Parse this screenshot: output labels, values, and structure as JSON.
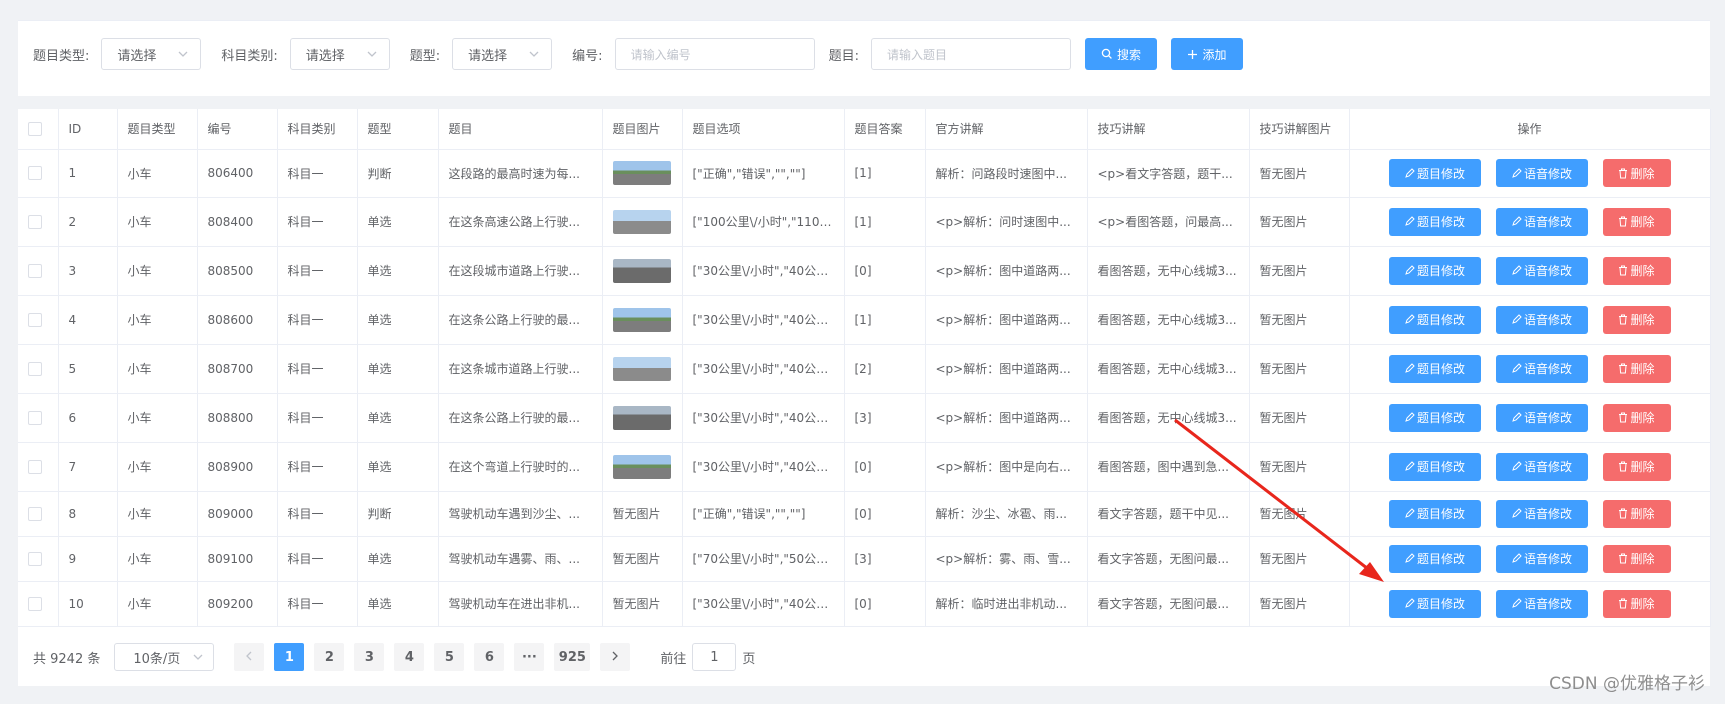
{
  "filters": {
    "type_label": "题目类型:",
    "type_value": "请选择",
    "subject_label": "科目类别:",
    "subject_value": "请选择",
    "kind_label": "题型:",
    "kind_value": "请选择",
    "code_label": "编号:",
    "code_placeholder": "请输入编号",
    "title_label": "题目:",
    "title_placeholder": "请输入题目",
    "search_label": "搜索",
    "add_label": "添加"
  },
  "table": {
    "headers": [
      "ID",
      "题目类型",
      "编号",
      "科目类别",
      "题型",
      "题目",
      "题目图片",
      "题目选项",
      "题目答案",
      "官方讲解",
      "技巧讲解",
      "技巧讲解图片",
      "操作"
    ],
    "edit_label": "题目修改",
    "voice_label": "语音修改",
    "delete_label": "删除",
    "rows": [
      {
        "id": "1",
        "type": "小车",
        "code": "806400",
        "subject": "科目一",
        "kind": "判断",
        "title": "这段路的最高时速为每...",
        "image": "photo",
        "options": "[\"正确\",\"错误\",\"\",\"\"]",
        "answer": "[1]",
        "official": "解析：问路段时速图中...",
        "tip": "<p>看文字答题，题干...",
        "tip_image": "暂无图片"
      },
      {
        "id": "2",
        "type": "小车",
        "code": "808400",
        "subject": "科目一",
        "kind": "单选",
        "title": "在这条高速公路上行驶...",
        "image": "photo",
        "options": "[\"100公里\\/小时\",\"110公...",
        "answer": "[1]",
        "official": "<p>解析：问时速图中...",
        "tip": "<p>看图答题，问最高...",
        "tip_image": "暂无图片"
      },
      {
        "id": "3",
        "type": "小车",
        "code": "808500",
        "subject": "科目一",
        "kind": "单选",
        "title": "在这段城市道路上行驶...",
        "image": "photo",
        "options": "[\"30公里\\/小时\",\"40公里...",
        "answer": "[0]",
        "official": "<p>解析：图中道路两...",
        "tip": "看图答题，无中心线城3...",
        "tip_image": "暂无图片"
      },
      {
        "id": "4",
        "type": "小车",
        "code": "808600",
        "subject": "科目一",
        "kind": "单选",
        "title": "在这条公路上行驶的最...",
        "image": "photo",
        "options": "[\"30公里\\/小时\",\"40公里...",
        "answer": "[1]",
        "official": "<p>解析：图中道路两...",
        "tip": "看图答题，无中心线城3...",
        "tip_image": "暂无图片"
      },
      {
        "id": "5",
        "type": "小车",
        "code": "808700",
        "subject": "科目一",
        "kind": "单选",
        "title": "在这条城市道路上行驶...",
        "image": "photo",
        "options": "[\"30公里\\/小时\",\"40公里...",
        "answer": "[2]",
        "official": "<p>解析：图中道路两...",
        "tip": "看图答题，无中心线城3...",
        "tip_image": "暂无图片"
      },
      {
        "id": "6",
        "type": "小车",
        "code": "808800",
        "subject": "科目一",
        "kind": "单选",
        "title": "在这条公路上行驶的最...",
        "image": "photo",
        "options": "[\"30公里\\/小时\",\"40公里...",
        "answer": "[3]",
        "official": "<p>解析：图中道路两...",
        "tip": "看图答题，无中心线城3...",
        "tip_image": "暂无图片"
      },
      {
        "id": "7",
        "type": "小车",
        "code": "808900",
        "subject": "科目一",
        "kind": "单选",
        "title": "在这个弯道上行驶时的...",
        "image": "photo",
        "options": "[\"30公里\\/小时\",\"40公里...",
        "answer": "[0]",
        "official": "<p>解析：图中是向右...",
        "tip": "看图答题，图中遇到急...",
        "tip_image": "暂无图片"
      },
      {
        "id": "8",
        "type": "小车",
        "code": "809000",
        "subject": "科目一",
        "kind": "判断",
        "title": "驾驶机动车遇到沙尘、...",
        "image": "暂无图片",
        "options": "[\"正确\",\"错误\",\"\",\"\"]",
        "answer": "[0]",
        "official": "解析：沙尘、冰雹、雨...",
        "tip": "看文字答题，题干中见...",
        "tip_image": "暂无图片"
      },
      {
        "id": "9",
        "type": "小车",
        "code": "809100",
        "subject": "科目一",
        "kind": "单选",
        "title": "驾驶机动车遇雾、雨、...",
        "image": "暂无图片",
        "options": "[\"70公里\\/小时\",\"50公里...",
        "answer": "[3]",
        "official": "<p>解析：雾、雨、雪...",
        "tip": "看文字答题，无图问最...",
        "tip_image": "暂无图片"
      },
      {
        "id": "10",
        "type": "小车",
        "code": "809200",
        "subject": "科目一",
        "kind": "单选",
        "title": "驾驶机动车在进出非机...",
        "image": "暂无图片",
        "options": "[\"30公里\\/小时\",\"40公里...",
        "answer": "[0]",
        "official": "解析：临时进出非机动...",
        "tip": "看文字答题，无图问最...",
        "tip_image": "暂无图片"
      }
    ]
  },
  "pagination": {
    "total": "共 9242 条",
    "page_size": "10条/页",
    "pages": [
      "1",
      "2",
      "3",
      "4",
      "5",
      "6"
    ],
    "ellipsis": "···",
    "last": "925",
    "goto_prefix": "前往",
    "goto_value": "1",
    "goto_suffix": "页"
  },
  "watermark": "CSDN @优雅格子衫",
  "colors": {
    "primary": "#409eff",
    "danger": "#f56c6c",
    "arrow": "#e8261c"
  }
}
